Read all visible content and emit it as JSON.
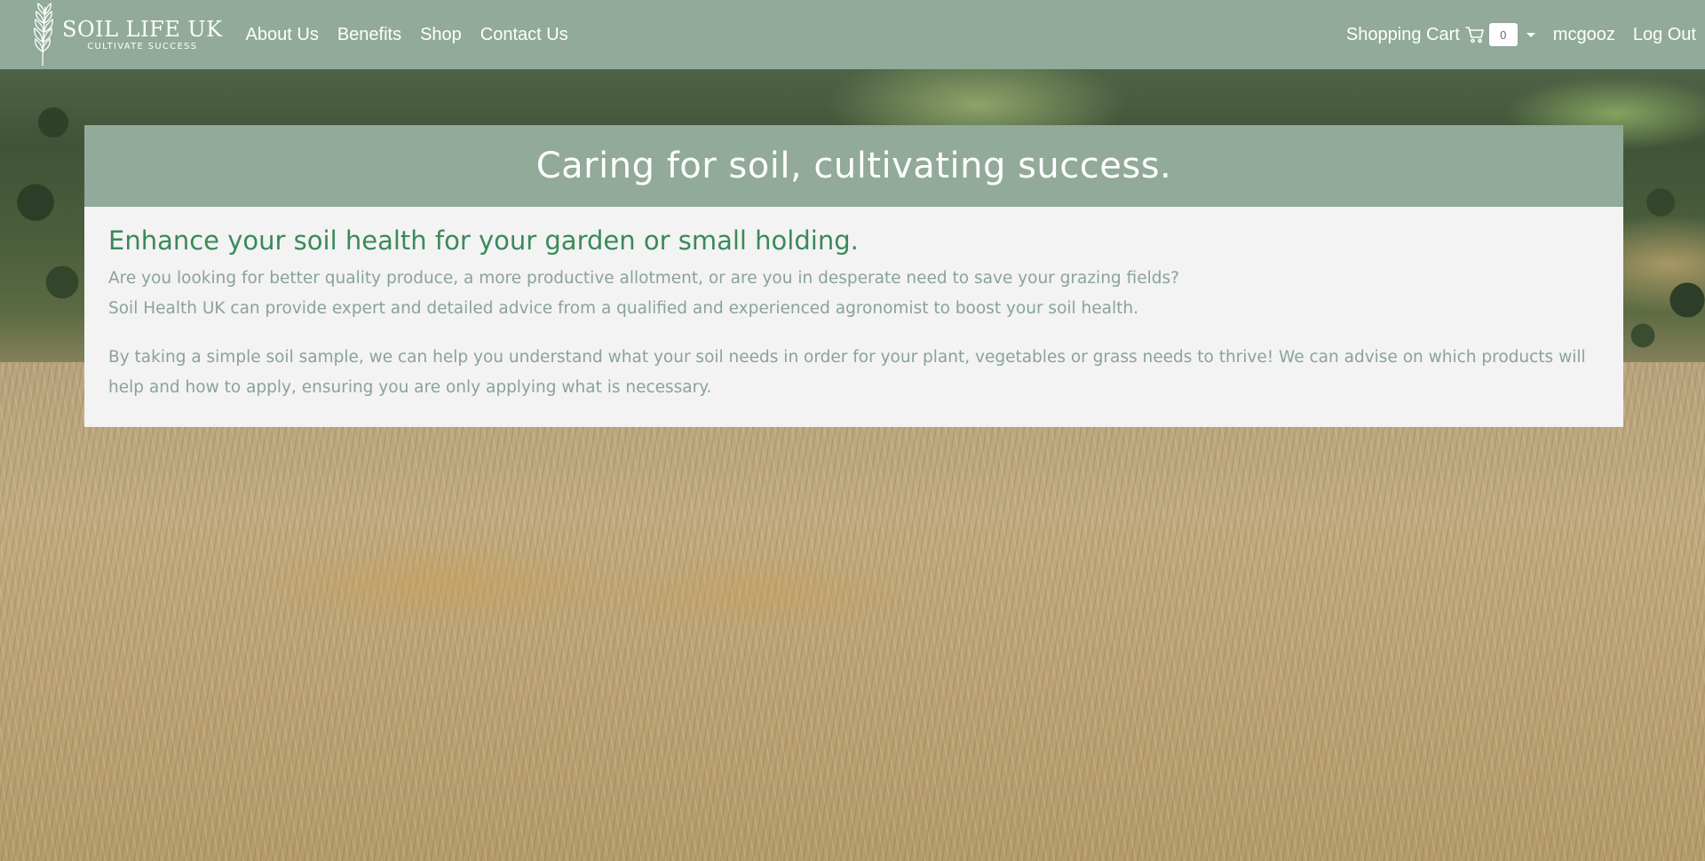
{
  "brand": {
    "name": "SOIL LIFE UK",
    "tagline": "CULTIVATE SUCCESS"
  },
  "nav": {
    "links": [
      "About Us",
      "Benefits",
      "Shop",
      "Contact Us"
    ],
    "cart_label": "Shopping Cart",
    "cart_count": "0",
    "username": "mcgooz",
    "logout_label": "Log Out"
  },
  "hero": {
    "title": "Caring for soil, cultivating success.",
    "heading": "Enhance your soil health for your garden or small holding.",
    "paragraph_1": "Are you looking for better quality produce, a more productive allotment, or are you in desperate need to save your grazing fields?",
    "paragraph_2": "Soil Health UK can provide expert and detailed advice from a qualified and experienced agronomist to boost your soil health.",
    "paragraph_3": "By taking a simple soil sample, we can help you understand what your soil needs in order for your plant, vegetables or grass needs to thrive! We can advise on which products will help and how to apply, ensuring you are only applying what is necessary."
  },
  "icons": {
    "logo": "wheat-icon",
    "cart": "shopping-cart-icon",
    "dropdown": "caret-down-icon"
  },
  "colors": {
    "navbar": "#91aa9a",
    "card_body": "#f3f3f3",
    "heading_green": "#3a8a5a",
    "text_muted": "#8aa396"
  }
}
